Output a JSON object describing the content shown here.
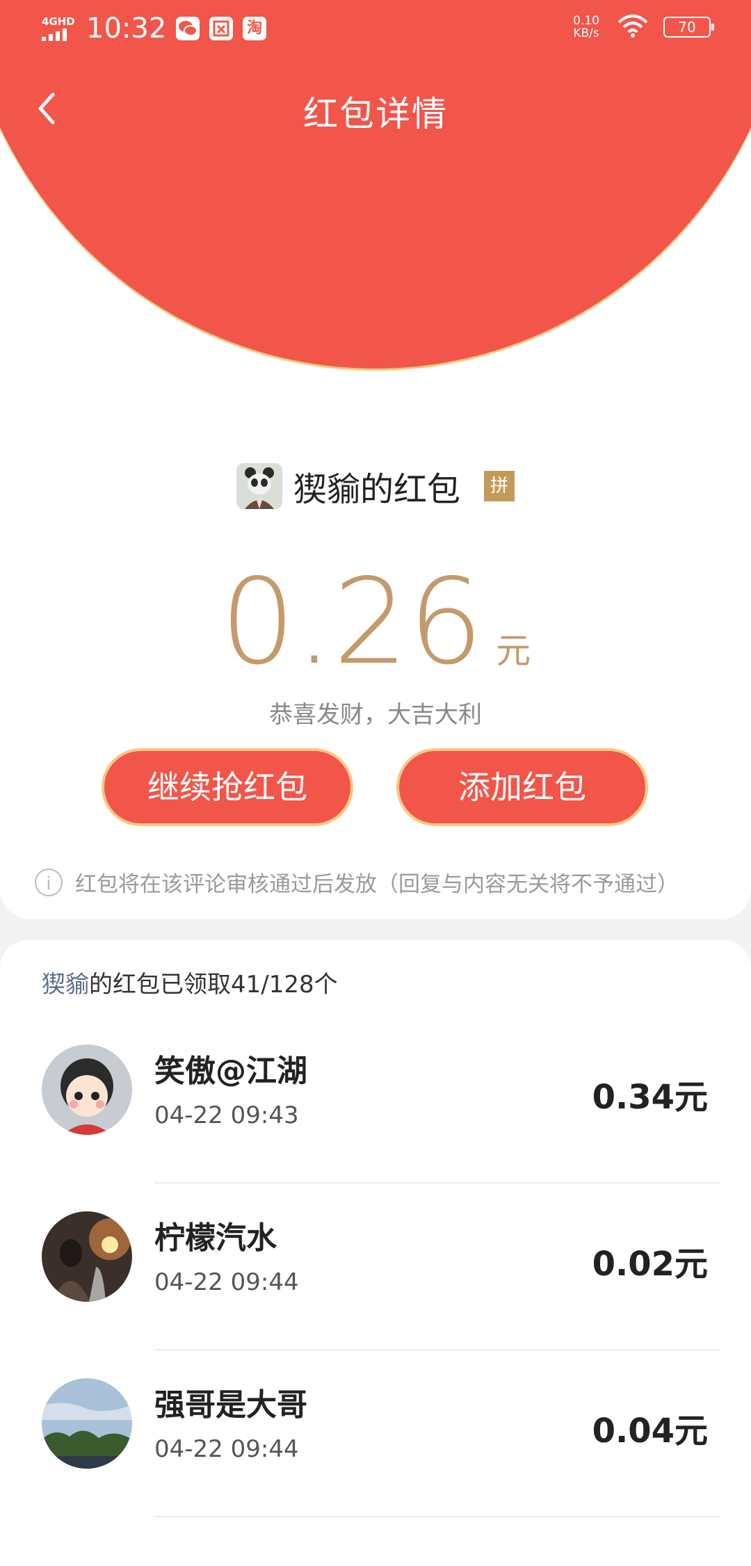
{
  "status_bar": {
    "network": "4GHD",
    "time": "10:32",
    "app_icons": [
      "wechat-icon",
      "bank-icon",
      "taobao-icon"
    ],
    "taobao_glyph": "淘",
    "speed_value": "0.10",
    "speed_unit": "KB/s",
    "battery": "70"
  },
  "header": {
    "title": "红包详情"
  },
  "packet": {
    "sender": "猰貐的红包",
    "badge": "拼",
    "amount": "0.26",
    "unit": "元",
    "blessing": "恭喜发财，大吉大利",
    "buttons": {
      "continue": "继续抢红包",
      "add": "添加红包"
    },
    "notice": "红包将在该评论审核通过后发放（回复与内容无关将不予通过）"
  },
  "claims": {
    "summary_name": "猰貐",
    "summary_text": "的红包已领取41/128个",
    "records": [
      {
        "name": "笑傲@江湖",
        "time": "04-22 09:43",
        "amount": "0.34元"
      },
      {
        "name": "柠檬汽水",
        "time": "04-22 09:44",
        "amount": "0.02元"
      },
      {
        "name": "强哥是大哥",
        "time": "04-22 09:44",
        "amount": "0.04元"
      }
    ]
  },
  "colors": {
    "red": "#f2554a",
    "gold": "#c49a6c",
    "nick_blue": "#5a6b8c"
  }
}
